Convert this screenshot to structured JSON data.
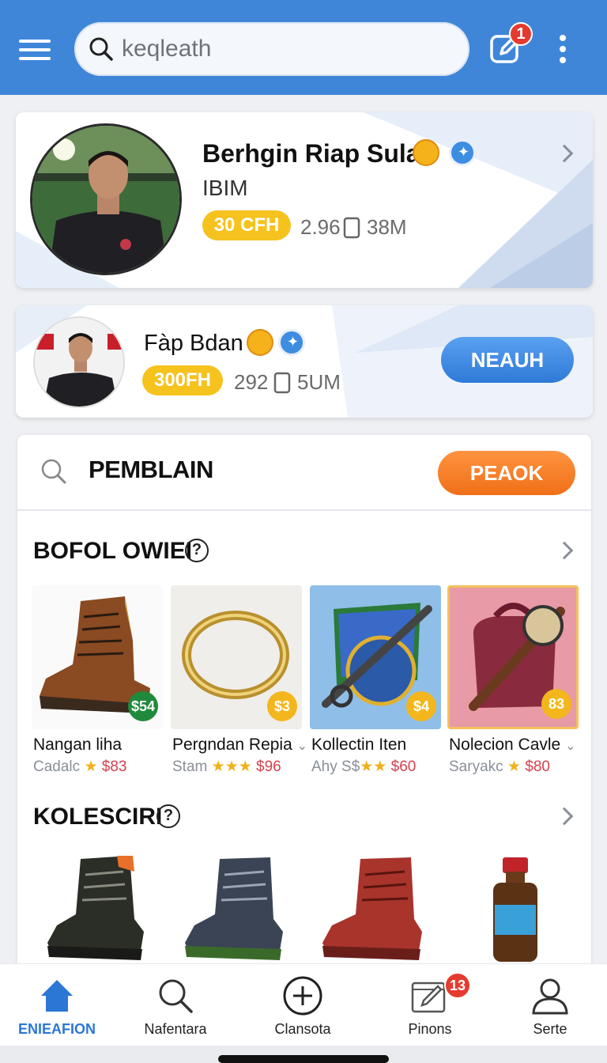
{
  "header": {
    "search_value": "keqleath",
    "notification_count": "1",
    "icons": [
      "menu-icon",
      "search-icon",
      "compose-icon",
      "more-vertical-icon"
    ]
  },
  "profiles": [
    {
      "name": "Berhgin Riap Sulan",
      "subtitle": "IBIM",
      "pill": "30 CFH",
      "stat_a": "2.96",
      "stat_b": "38M"
    },
    {
      "name": "Fàp Bdan",
      "pill": "300FH",
      "stat_a": "292",
      "stat_b": "5UM",
      "button": "NEAUH"
    }
  ],
  "panel": {
    "search_label": "PEMBLAIN",
    "action_button": "PEAOK",
    "section1_title": "BOFOL OWIEI",
    "section2_title": "KOLESCIRI",
    "help_glyph": "?",
    "items": [
      {
        "name": "Nangan liha",
        "seller": "Cadalc",
        "stars": "★",
        "value": "$83",
        "price": "$54",
        "price_color": "#1f8a3b"
      },
      {
        "name": "Pergndan Repia",
        "seller": "Stam",
        "stars": "★★★",
        "value": "$96",
        "price": "$3",
        "price_color": "#f3b71d"
      },
      {
        "name": "Kollectin Iten",
        "seller": "Ahy S$",
        "stars": "★★",
        "value": "$60",
        "price": "$4",
        "price_color": "#f3b71d"
      },
      {
        "name": "Nolecion Cavle",
        "seller": "Saryakc",
        "stars": "★",
        "value": "$80",
        "price": "83",
        "price_color": "#f3b71d"
      }
    ]
  },
  "bottom_nav": [
    {
      "label": "ENIEAFION",
      "icon": "home-icon",
      "active": true
    },
    {
      "label": "Nafentara",
      "icon": "search-icon"
    },
    {
      "label": "Clansota",
      "icon": "add-circle-icon"
    },
    {
      "label": "Pinons",
      "icon": "edit-icon",
      "badge": "13"
    },
    {
      "label": "Serte",
      "icon": "profile-icon"
    }
  ]
}
